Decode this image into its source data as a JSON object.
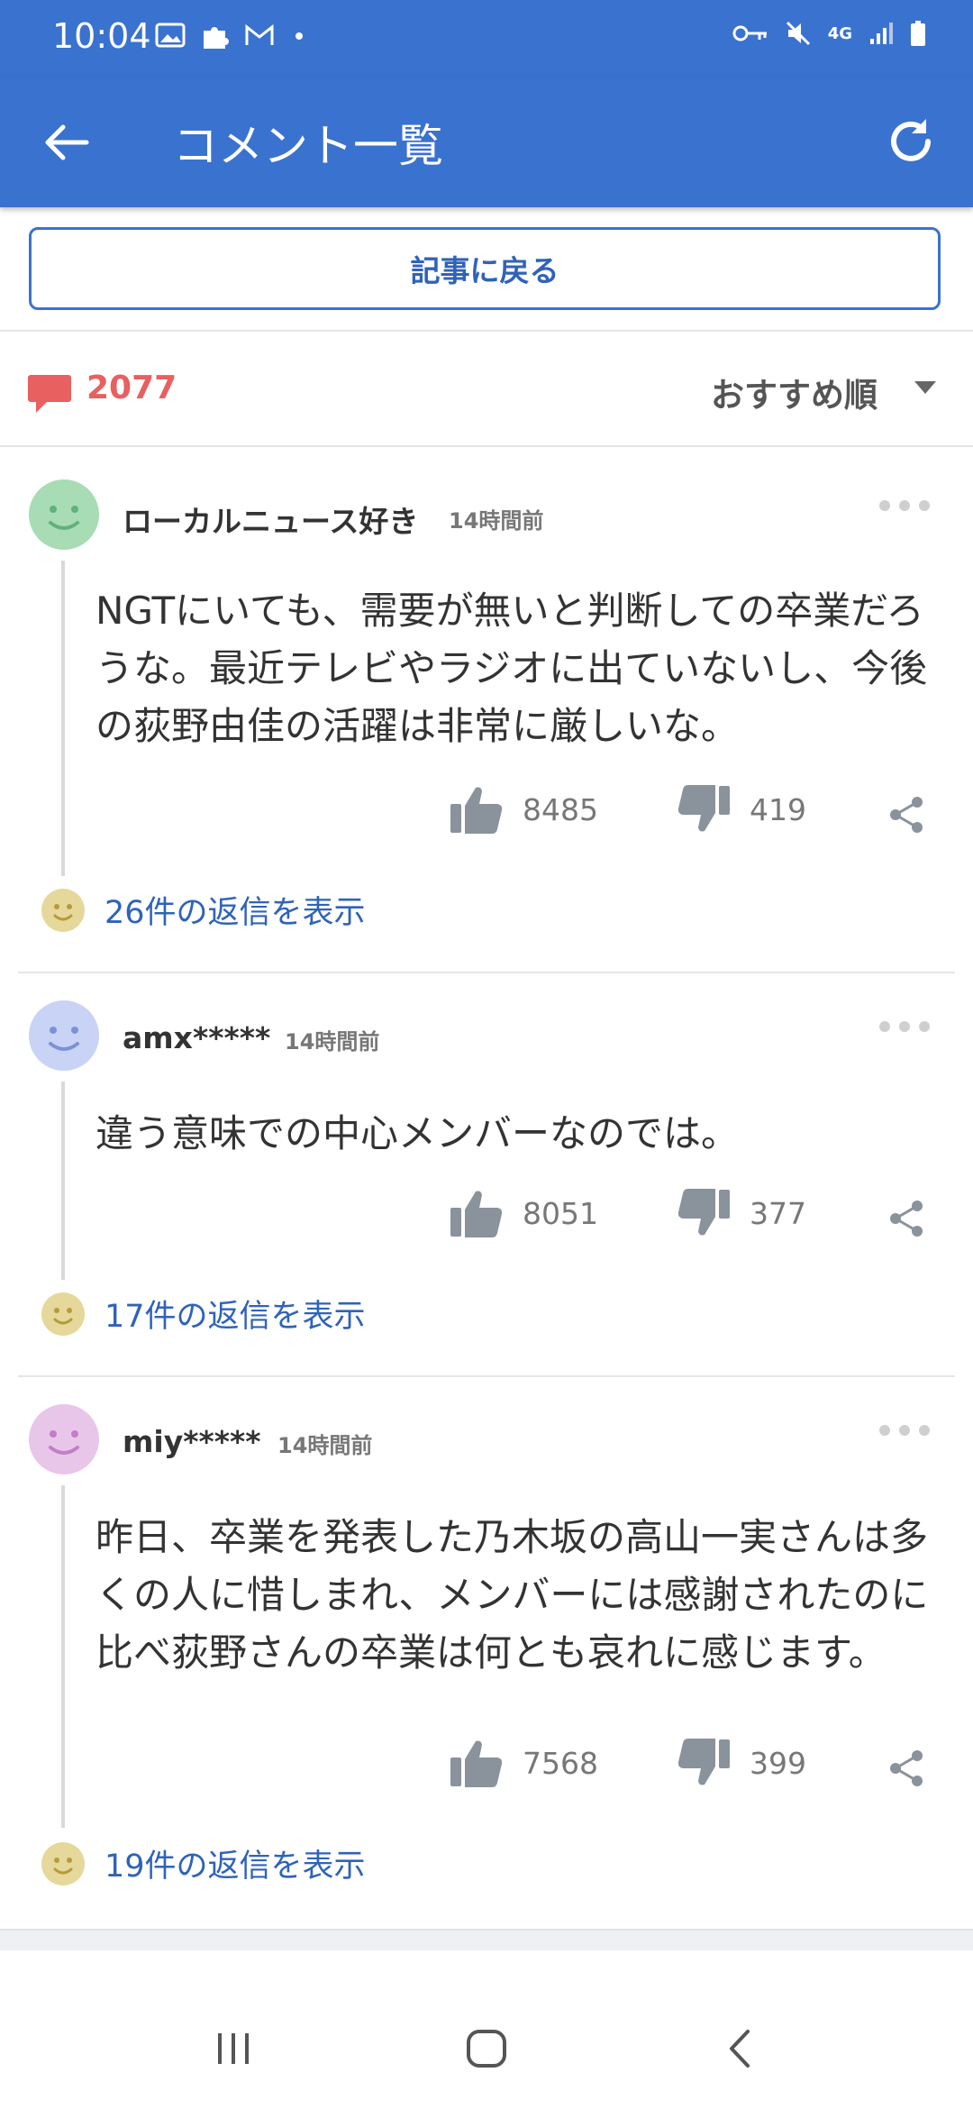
{
  "status": {
    "time": "10:04",
    "network": "4G"
  },
  "appbar": {
    "title": "コメント一覧"
  },
  "back_to_article": "記事に戻る",
  "comment_count": "2077",
  "sort": {
    "selected": "おすすめ順"
  },
  "comments": [
    {
      "user": "ローカルニュース好き",
      "time": "14時間前",
      "text": "NGTにいても、需要が無いと判断しての卒業だろうな。最近テレビやラジオに出ていないし、今後の荻野由佳の活躍は非常に厳しいな。",
      "likes": "8485",
      "dislikes": "419",
      "replies": "26件の返信を表示",
      "avatar_color": "#a8dcb4",
      "face_color": "#5fb27a"
    },
    {
      "user": "amx*****",
      "time": "14時間前",
      "text": "違う意味での中心メンバーなのでは。",
      "likes": "8051",
      "dislikes": "377",
      "replies": "17件の返信を表示",
      "avatar_color": "#c9d3f5",
      "face_color": "#7b92d8"
    },
    {
      "user": "miy*****",
      "time": "14時間前",
      "text": "昨日、卒業を発表した乃木坂の高山一実さんは多くの人に惜しまれ、メンバーには感謝されたのに比べ荻野さんの卒業は何とも哀れに感じます。",
      "likes": "7568",
      "dislikes": "399",
      "replies": "19件の返信を表示",
      "avatar_color": "#e8c6ea",
      "face_color": "#c27ec8"
    }
  ],
  "colors": {
    "accent": "#3a72cf",
    "count": "#e8605f",
    "link": "#2f63b8"
  }
}
